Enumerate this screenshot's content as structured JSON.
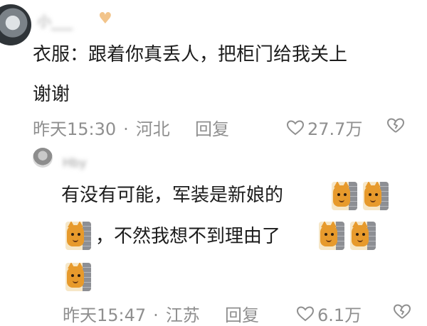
{
  "comments": [
    {
      "username": "小___",
      "text_line1": "衣服：跟着你真丢人，把柜门给我关上",
      "text_line2": "谢谢",
      "time": "昨天15:30",
      "location": "河北",
      "reply_label": "回复",
      "likes": "27.7万"
    },
    {
      "username": "Hby",
      "text_line1": "有没有可能，军装是新娘的",
      "text_line2": "，不然我想不到理由了",
      "time": "昨天15:47",
      "location": "江苏",
      "reply_label": "回复",
      "likes": "6.1万"
    }
  ],
  "separator": "·",
  "icons": {
    "like": "heart-outline-icon",
    "dislike": "broken-heart-icon",
    "emoji": "cat-behind-wall-emoji"
  },
  "colors": {
    "text": "#1c1c1c",
    "meta": "#8f8f8f",
    "background": "#ffffff"
  }
}
